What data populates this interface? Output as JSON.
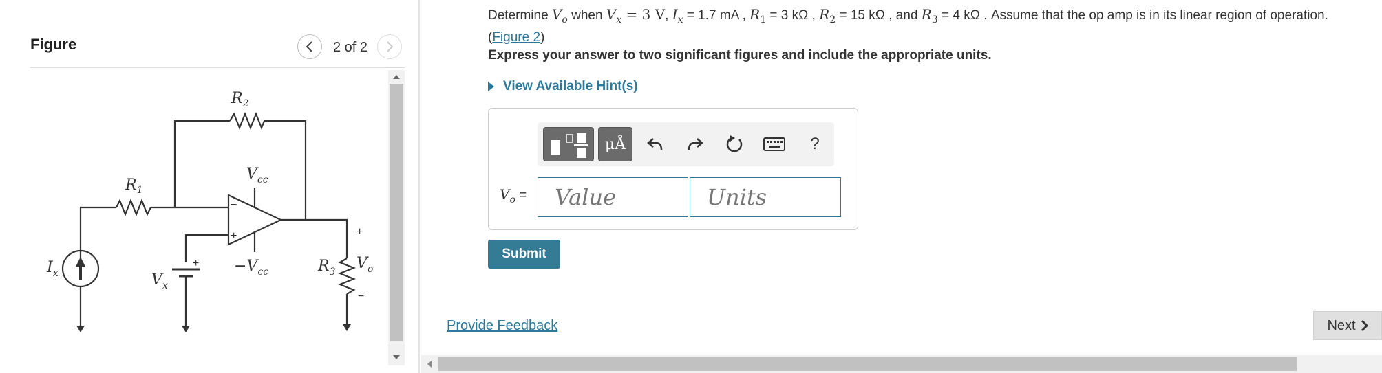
{
  "figure_panel": {
    "title": "Figure",
    "page_counter": "2 of 2",
    "circuit_labels": {
      "r1": "R",
      "r1_sub": "1",
      "r2": "R",
      "r2_sub": "2",
      "r3": "R",
      "r3_sub": "3",
      "vcc": "V",
      "vcc_sub": "cc",
      "neg_vcc": "−V",
      "neg_vcc_sub": "cc",
      "ix": "I",
      "ix_sub": "x",
      "vx": "V",
      "vx_sub": "x",
      "vo": "V",
      "vo_sub": "o",
      "plus": "+",
      "minus": "−"
    }
  },
  "question": {
    "determine": "Determine ",
    "vo": "V",
    "vo_sub": "o",
    "when": " when ",
    "vx_eq": "V",
    "vx_sub": "x",
    "vx_val": " = 3 V",
    "ix_eq": "I",
    "ix_sub": "x",
    "ix_val": " = 1.7 mA",
    "r1": "R",
    "r1_sub": "1",
    "r1_val": " = 3 kΩ",
    "r2": "R",
    "r2_sub": "2",
    "r2_val": " = 15 kΩ",
    "and": " , and ",
    "r3": "R",
    "r3_sub": "3",
    "r3_val": " = 4 kΩ",
    "assume": " . Assume that the op amp is in its linear region of operation.",
    "figure_link": "Figure 2",
    "instruction": "Express your answer to two significant figures and include the appropriate units.",
    "hints": "View Available Hint(s)"
  },
  "answer": {
    "label_var": "V",
    "label_sub": "o",
    "label_eq": " =",
    "value_placeholder": "Value",
    "units_placeholder": "Units",
    "units_symbol": "μÅ",
    "help": "?"
  },
  "buttons": {
    "submit": "Submit",
    "feedback": "Provide Feedback",
    "next": "Next"
  }
}
